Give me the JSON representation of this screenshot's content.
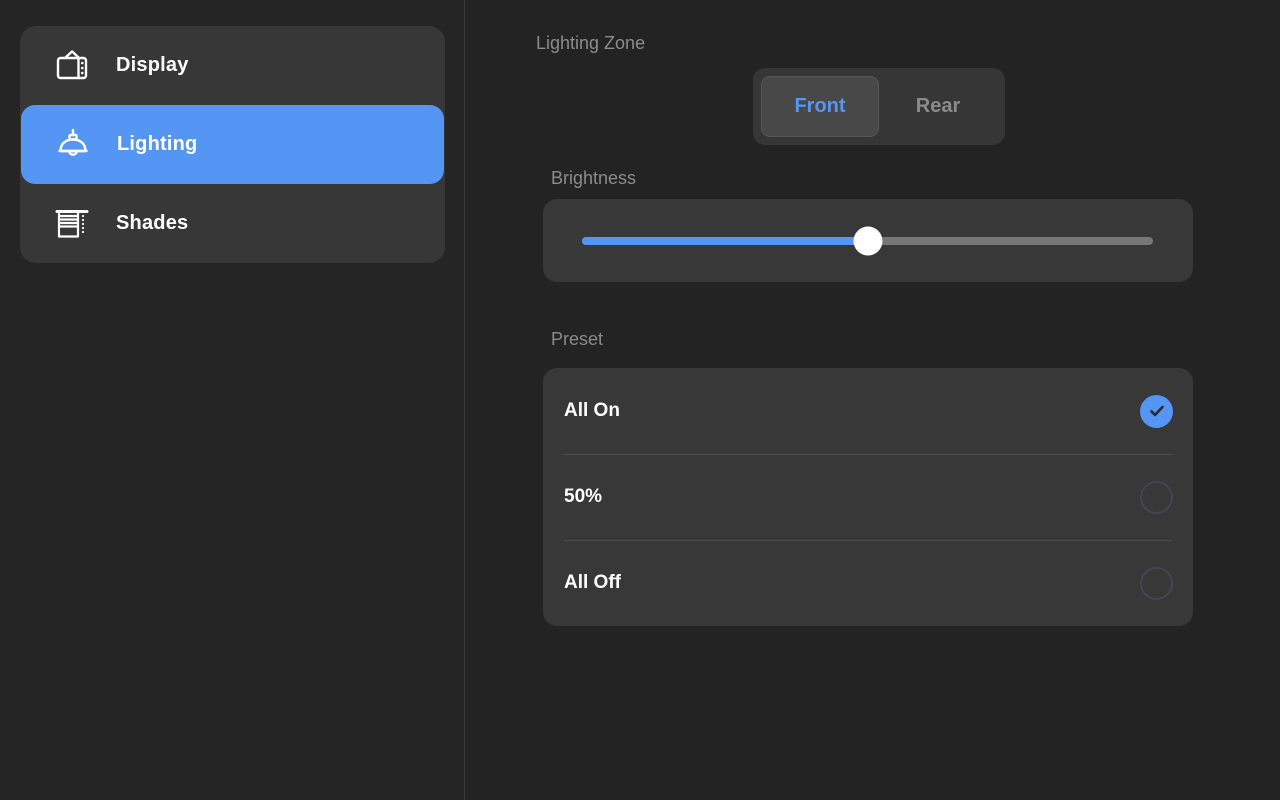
{
  "theme": {
    "background": "#252525",
    "panel": "#383838",
    "accent": "#5596f5",
    "text_primary": "#ffffff",
    "text_muted": "#8b8b8b",
    "divider": "#4d4d4d"
  },
  "sidebar": {
    "items": [
      {
        "label": "Display",
        "icon": "tv-icon",
        "selected": false
      },
      {
        "label": "Lighting",
        "icon": "lamp-icon",
        "selected": true
      },
      {
        "label": "Shades",
        "icon": "blinds-icon",
        "selected": false
      }
    ]
  },
  "main": {
    "zone": {
      "label": "Lighting Zone",
      "options": [
        {
          "label": "Front",
          "selected": true
        },
        {
          "label": "Rear",
          "selected": false
        }
      ]
    },
    "brightness": {
      "label": "Brightness",
      "value": 50,
      "min": 0,
      "max": 100
    },
    "preset": {
      "label": "Preset",
      "options": [
        {
          "label": "All On",
          "selected": true
        },
        {
          "label": "50%",
          "selected": false
        },
        {
          "label": "All Off",
          "selected": false
        }
      ]
    }
  }
}
